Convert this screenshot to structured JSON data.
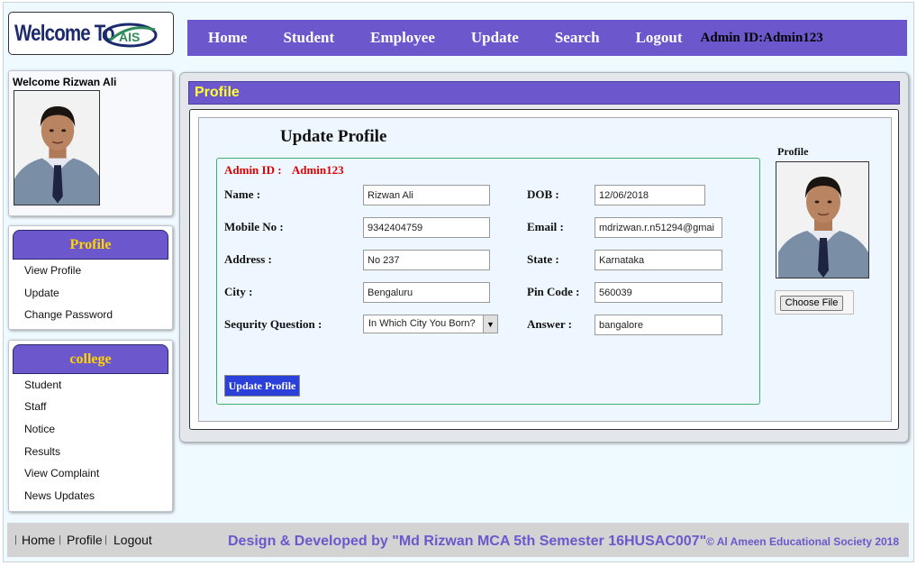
{
  "header": {
    "logo_text": "Welcome To",
    "logo_mark_text": "AIS",
    "nav": [
      "Home",
      "Student",
      "Employee",
      "Update",
      "Search",
      "Logout"
    ],
    "admin_id_text": "Admin ID:Admin123"
  },
  "sidebar": {
    "welcome_text": "Welcome Rizwan Ali",
    "profile_menu": {
      "title": "Profile",
      "items": [
        "View Profile",
        "Update",
        "Change Password"
      ]
    },
    "college_menu": {
      "title": "college",
      "items": [
        "Student",
        "Staff",
        "Notice",
        "Results",
        "View Complaint",
        "News Updates"
      ]
    }
  },
  "main": {
    "section_title": "Profile",
    "form_title": "Update Profile",
    "admin_id_label": "Admin ID :",
    "admin_id_value": "Admin123",
    "fields": {
      "name": {
        "label": "Name :",
        "value": "Rizwan Ali"
      },
      "dob": {
        "label": "DOB :",
        "value": "12/06/2018"
      },
      "mobile": {
        "label": "Mobile No :",
        "value": "9342404759"
      },
      "email": {
        "label": "Email :",
        "value": "mdrizwan.r.n51294@gmai"
      },
      "address": {
        "label": "Address :",
        "value": "No 237"
      },
      "state": {
        "label": "State :",
        "value": "Karnataka"
      },
      "city": {
        "label": "City :",
        "value": "Bengaluru"
      },
      "pincode": {
        "label": "Pin Code :",
        "value": "560039"
      },
      "security_question": {
        "label": "Sequrity Question :",
        "value": "In Which City You Born?"
      },
      "answer": {
        "label": "Answer :",
        "value": "bangalore"
      }
    },
    "submit_label": "Update Profile",
    "profile_photo_label": "Profile",
    "choose_file_label": "Choose File"
  },
  "footer": {
    "links": [
      "Home",
      "Profile",
      "Logout"
    ],
    "credit": "Design & Developed by \"Md Rizwan MCA 5th Semester 16HUSAC007\"",
    "copyright": "© Al Ameen Educational Society 2018"
  },
  "colors": {
    "accent_purple": "#6c58cc",
    "menu_heading_yellow": "#ffd400",
    "admin_red": "#e00000",
    "button_blue": "#2b40d8",
    "form_border_green": "#3cb371"
  }
}
